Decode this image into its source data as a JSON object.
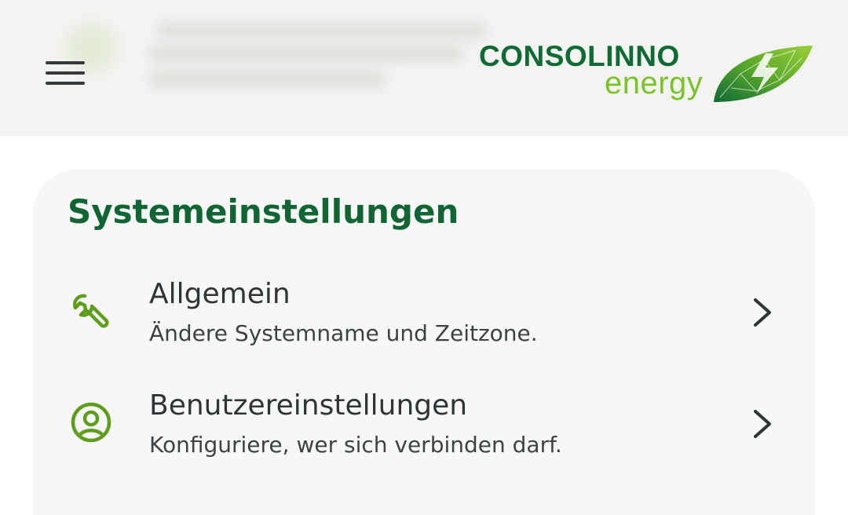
{
  "header": {
    "menu_icon": "hamburger-menu-icon",
    "logo": {
      "line1": "CONSOLINNO",
      "line2": "energy",
      "icon": "leaf-lightning-icon"
    }
  },
  "settings": {
    "title": "Systemeinstellungen",
    "items": [
      {
        "label": "Allgemein",
        "description": "Ändere Systemname und Zeitzone.",
        "icon": "wrench-icon"
      },
      {
        "label": "Benutzereinstellungen",
        "description": "Konfiguriere, wer sich verbinden darf.",
        "icon": "user-circle-icon"
      }
    ]
  },
  "colors": {
    "brand_dark_green": "#0f6a35",
    "brand_light_green": "#7cc22b",
    "icon_green": "#5f9e1c",
    "header_bg": "#f3f3f2",
    "card_bg": "#f7f7f7",
    "text": "#2f3536"
  }
}
